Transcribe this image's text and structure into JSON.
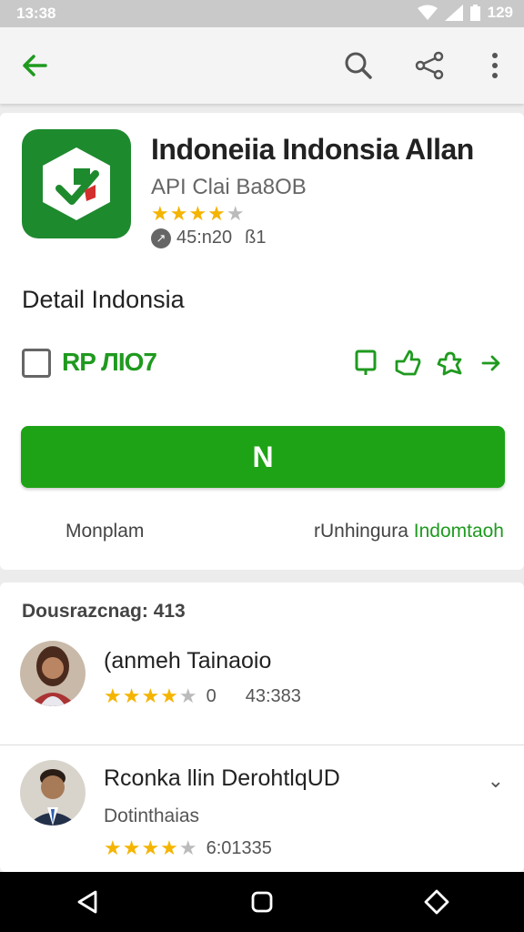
{
  "status_bar": {
    "time": "13:38",
    "battery": "129"
  },
  "app_bar": {
    "back_icon": "arrow-left-icon",
    "search_icon": "search-icon",
    "share_icon": "share-icon",
    "more_icon": "more-vert-icon"
  },
  "app": {
    "title": "Indoneiia  Indonsia Allan",
    "developer": "API Clai Ba8OB",
    "rating_stars": "★★★★",
    "rating_empty": "★",
    "size": "45:n20",
    "downloads": "ß1"
  },
  "detail": {
    "title": "Detail Indonsia",
    "price": "RP ЛIO7",
    "install_label": "N",
    "footer_left": "Monplam",
    "footer_right_prefix": "rUnhingura",
    "footer_right_link": "Indomtaoh"
  },
  "reviews": {
    "heading": "Dousrazcnag: 413",
    "items": [
      {
        "name": "(anmeh Tainaoio",
        "stars": "★★★★",
        "empty": "★",
        "rating_text": "0",
        "date": "43:383"
      },
      {
        "name": "Rconka llin DerohtlqUD",
        "subtitle": "Dotinthaias",
        "stars": "★★★★",
        "empty": "★",
        "rating_text": "6:01335"
      }
    ]
  },
  "colors": {
    "accent": "#1ea316",
    "app_icon": "#1e8a2e",
    "star": "#f4b400"
  }
}
